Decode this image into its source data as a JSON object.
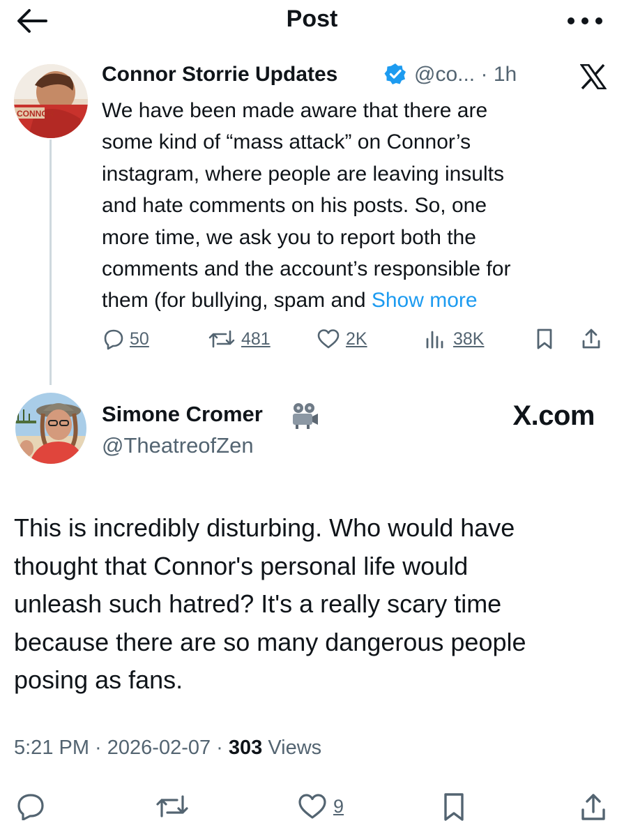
{
  "header": {
    "title": "Post",
    "back_icon": "arrow-left-icon",
    "more_icon": "more-horizontal-icon"
  },
  "quoted_post": {
    "author_name": "Connor Storrie Updates",
    "verified": true,
    "handle": "@co...",
    "separator": "·",
    "time": "1h",
    "avatar_caption": "CONNOR",
    "body_lines": [
      "We have been made aware that there are",
      "some kind of “mass attack” on Connor’s",
      "instagram, where people are leaving insults",
      "and hate comments on his posts. So, one",
      "more time, we ask you to report both the",
      "comments and the account’s responsible for"
    ],
    "body_last_line": "them (for bullying, spam and ",
    "show_more": "Show more",
    "stats": {
      "replies": "50",
      "reposts": "481",
      "likes": "2K",
      "views": "38K"
    }
  },
  "post": {
    "author_name": "Simone Cromer",
    "author_emoji": "projector-icon",
    "handle": "@TheatreofZen",
    "watermark": "X.com",
    "body_lines": [
      "This is incredibly disturbing. Who would have",
      "thought that Connor's personal life would",
      "unleash such hatred? It's a really scary time",
      "because there are so many dangerous people",
      "posing as fans."
    ],
    "time": "5:21 PM",
    "dot1": " · ",
    "date": "2026-02-07",
    "dot2": " · ",
    "views_count": "303",
    "views_label": " Views",
    "stats": {
      "likes": "9"
    }
  },
  "colors": {
    "text": "#0f1419",
    "muted": "#536471",
    "link": "#1d9bf0",
    "verified": "#1d9bf0",
    "thread_line": "#cfd9de"
  }
}
